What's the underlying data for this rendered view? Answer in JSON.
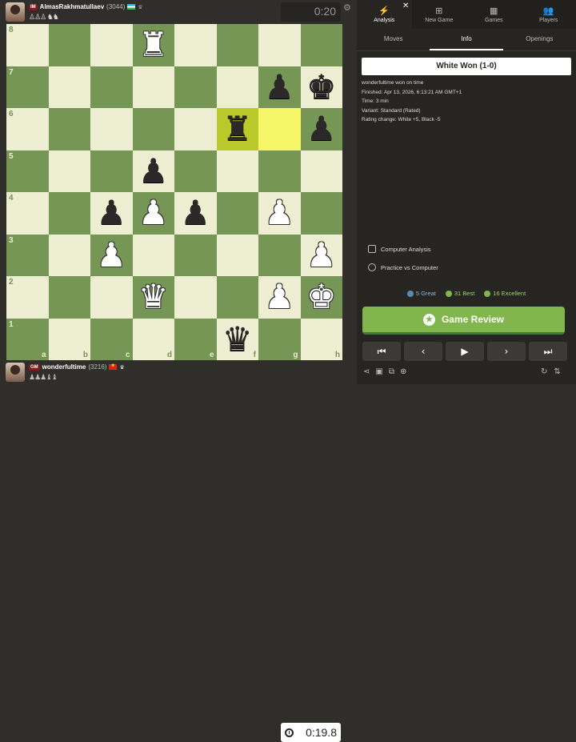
{
  "top_player": {
    "title": "IM",
    "name": "AlmasRakhmatullaev",
    "rating": "(3044)",
    "flag": "uz",
    "captured": "♙♙♙ ♞♞",
    "clock": "0:20"
  },
  "bottom_player": {
    "title": "GM",
    "name": "wonderfultime",
    "rating": "(3216)",
    "flag": "vn",
    "captured": "♟♟♟♝♝",
    "clock": "0:19.8"
  },
  "board": {
    "files": [
      "a",
      "b",
      "c",
      "d",
      "e",
      "f",
      "g",
      "h"
    ],
    "ranks": [
      "8",
      "7",
      "6",
      "5",
      "4",
      "3",
      "2",
      "1"
    ],
    "highlight": [
      "f6",
      "g6"
    ],
    "pieces": {
      "d8": "wR",
      "g7": "bP",
      "h7": "bK",
      "f6": "bR",
      "h6": "bP",
      "d5": "bP",
      "c4": "bP",
      "d4": "wP",
      "e4": "bP",
      "g4": "wP",
      "c3": "wP",
      "h3": "wP",
      "d2": "wQ",
      "g2": "wP",
      "h2": "wK",
      "f1": "bQ"
    }
  },
  "nav_tabs": [
    {
      "label": "Analysis",
      "icon": "lightning-icon",
      "glyph": "⚡",
      "active": true
    },
    {
      "label": "New Game",
      "icon": "plus-icon",
      "glyph": "⊞",
      "active": false
    },
    {
      "label": "Games",
      "icon": "board-icon",
      "glyph": "▦",
      "active": false
    },
    {
      "label": "Players",
      "icon": "players-icon",
      "glyph": "👥",
      "active": false
    }
  ],
  "sub_tabs": [
    {
      "label": "Moves",
      "active": false
    },
    {
      "label": "Info",
      "active": true
    },
    {
      "label": "Openings",
      "active": false
    }
  ],
  "result": "White Won (1-0)",
  "info_lines": [
    "wonderfultime won on time",
    "Finished: Apr 13, 2026, 6:13:21 AM GMT+1",
    "Time: 3 min",
    "Variant: Standard (Rated)",
    "Rating change: White +5, Black -5"
  ],
  "actions": {
    "computer_analysis": "Computer Analysis",
    "practice_vs_computer": "Practice vs Computer"
  },
  "stats": [
    {
      "label": "5 Great",
      "color": "#5c8bb0"
    },
    {
      "label": "31 Best",
      "color": "#81b64c"
    },
    {
      "label": "16 Excellent",
      "color": "#81b64c"
    }
  ],
  "review_label": "Game Review",
  "nav_buttons": [
    "⏮",
    "‹",
    "▶",
    "›",
    "⏭"
  ]
}
